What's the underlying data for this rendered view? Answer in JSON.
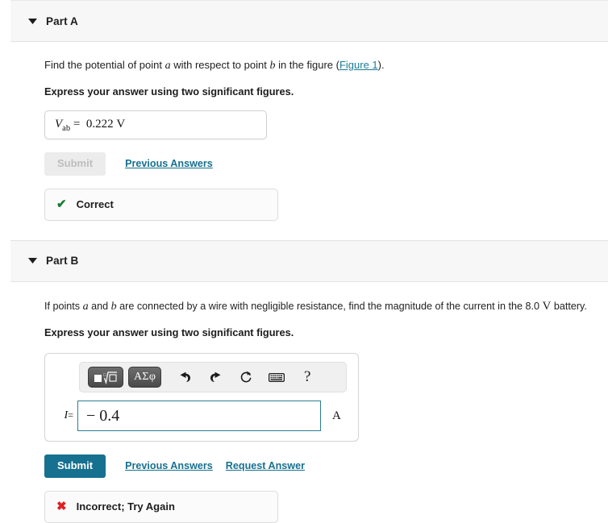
{
  "partA": {
    "title": "Part A",
    "caret": "chevron-down",
    "question_pre": "Find the potential of point ",
    "question_var1": "a",
    "question_mid": " with respect to point ",
    "question_var2": "b",
    "question_post": " in the figure (",
    "figure_link": "Figure 1",
    "question_end": ").",
    "instruction": "Express your answer using two significant figures.",
    "answer_symbol": "V",
    "answer_subscript": "ab",
    "answer_equals": "=",
    "answer_value": "0.222",
    "answer_unit": "V",
    "submit_label": "Submit",
    "previous_answers_label": "Previous Answers",
    "feedback_icon": "✔",
    "feedback_text": "Correct"
  },
  "partB": {
    "title": "Part B",
    "caret": "chevron-down",
    "question_pre": "If points ",
    "question_var1": "a",
    "question_and": " and ",
    "question_var2": "b",
    "question_mid": " are connected by a wire with negligible resistance, find the magnitude of the current in the 8.0 ",
    "question_unit": "V",
    "question_end": " battery.",
    "instruction": "Express your answer using two significant figures.",
    "toolbar": {
      "template_button": "square-root-template",
      "greek_button": "ΑΣφ",
      "undo": "undo-arrow",
      "redo": "redo-arrow",
      "reset": "reset-circle",
      "keyboard": "keyboard",
      "help": "?"
    },
    "entry_label": "I",
    "entry_equals": "=",
    "entry_value": "− 0.4",
    "entry_unit": "A",
    "submit_label": "Submit",
    "previous_answers_label": "Previous Answers",
    "request_answer_label": "Request Answer",
    "feedback_icon": "✖",
    "feedback_text": "Incorrect; Try Again"
  },
  "colors": {
    "accent": "#16708f",
    "link": "#1a7b99",
    "correct": "#1a7a34",
    "incorrect": "#e02020",
    "header_bg": "#f7f7f7",
    "field_border": "#2d7d91"
  }
}
